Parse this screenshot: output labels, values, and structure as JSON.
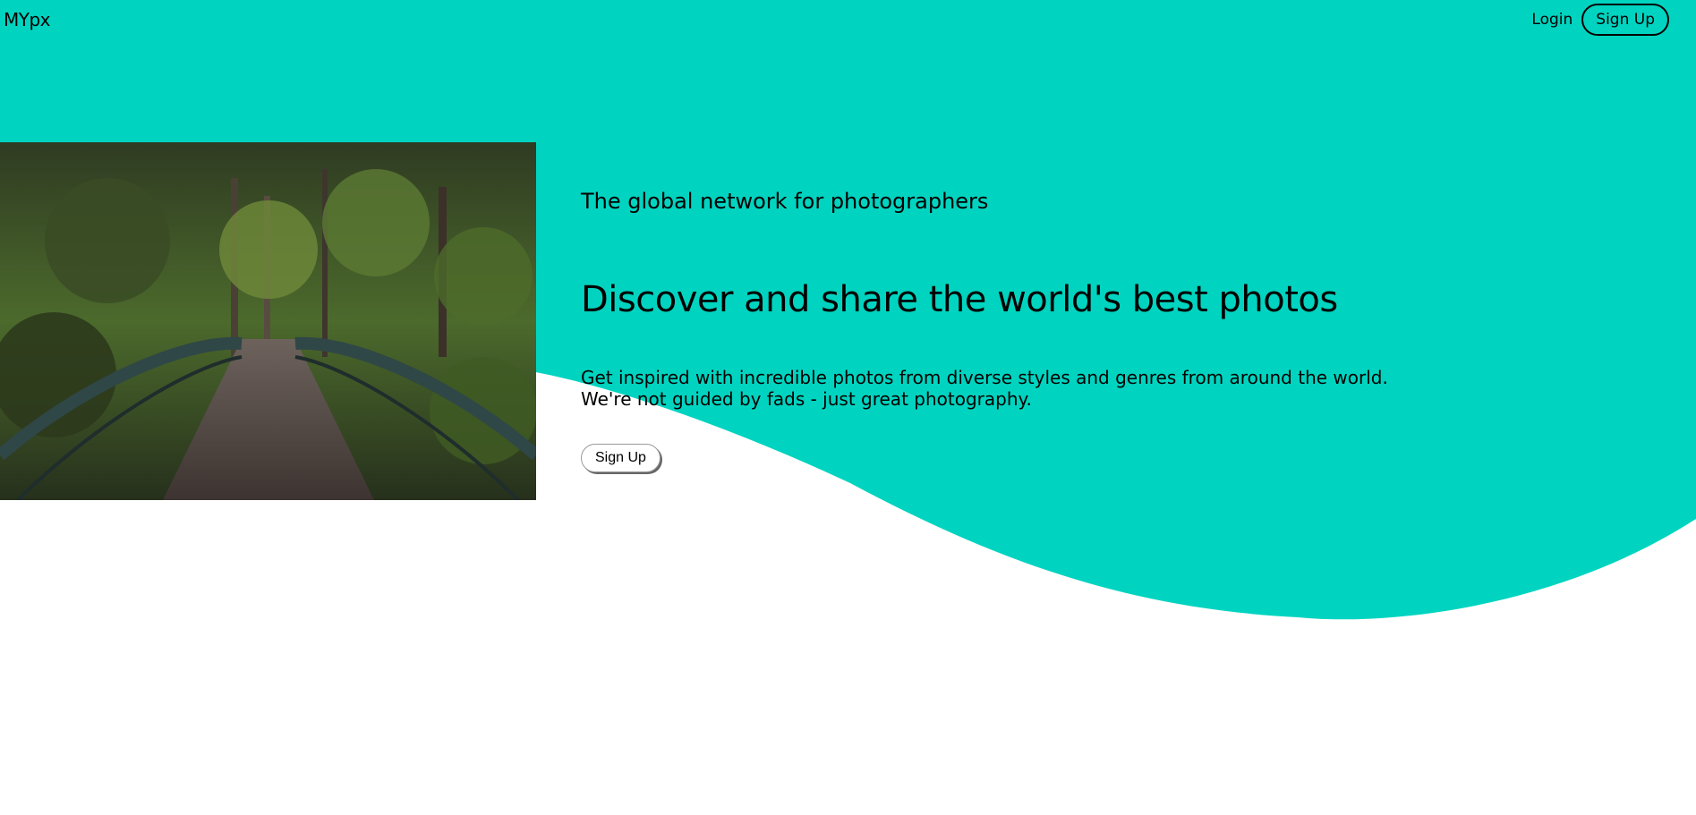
{
  "header": {
    "brand": "MYpx",
    "login_label": "Login",
    "signup_label": "Sign Up"
  },
  "hero": {
    "tagline": "The global network for photographers",
    "headline": "Discover and share the world's best photos",
    "description_line1": "Get inspired with incredible photos from diverse styles and genres from around the world.",
    "description_line2": "We're not guided by fads - just great photography.",
    "cta_label": "Sign Up",
    "image_subject": "forest-bridge-photo"
  },
  "colors": {
    "accent": "#00d4c0",
    "background": "#ffffff",
    "text": "#000000"
  }
}
